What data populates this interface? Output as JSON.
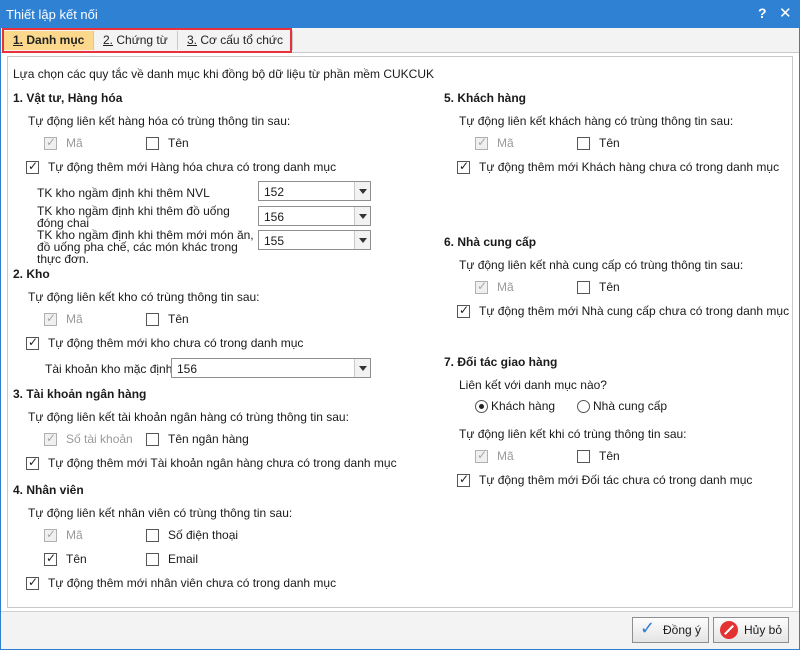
{
  "window": {
    "title": "Thiết lập kết nối",
    "help": "?",
    "close": "✕"
  },
  "tabs": [
    {
      "num": "1.",
      "label": " Danh mục"
    },
    {
      "num": "2.",
      "label": " Chứng từ"
    },
    {
      "num": "3.",
      "label": " Cơ cấu tổ chức"
    }
  ],
  "intro": "Lựa chọn các quy tắc về danh mục khi đồng bộ dữ liệu từ phần mềm CUKCUK",
  "s1": {
    "title": "1. Vật tư, Hàng hóa",
    "link_label": "Tự động liên kết hàng hóa có trùng thông tin sau:",
    "ma": "Mã",
    "ten": "Tên",
    "auto_add": "Tự động thêm mới Hàng hóa chưa có trong danh mục",
    "tk1_label": "TK kho ngầm định khi thêm NVL",
    "tk1_val": "152",
    "tk2_label": "TK kho ngầm định khi thêm đồ uống đóng chai",
    "tk2_val": "156",
    "tk3_label": "TK kho ngầm định khi thêm mới món ăn, đồ uống pha chế, các món khác trong thực đơn.",
    "tk3_val": "155"
  },
  "s2": {
    "title": "2. Kho",
    "link_label": "Tự động liên kết kho có trùng thông tin sau:",
    "ma": "Mã",
    "ten": "Tên",
    "auto_add": "Tự động thêm mới kho chưa có trong danh mục",
    "tk_label": "Tài khoản kho mặc định",
    "tk_val": "156"
  },
  "s3": {
    "title": "3. Tài khoản ngân hàng",
    "link_label": "Tự động liên kết tài khoản ngân hàng có trùng thông tin sau:",
    "so_tk": "Số tài khoản",
    "ten_nh": "Tên ngân hàng",
    "auto_add": "Tự động thêm mới Tài khoản ngân hàng chưa có trong danh mục"
  },
  "s4": {
    "title": "4. Nhân viên",
    "link_label": "Tự động liên kết nhân viên có trùng thông tin sau:",
    "ma": "Mã",
    "sdt": "Số điện thoại",
    "ten": "Tên",
    "email": "Email",
    "auto_add": "Tự động thêm mới nhân viên chưa có trong danh mục"
  },
  "s5": {
    "title": "5. Khách hàng",
    "link_label": "Tự động liên kết khách hàng có trùng thông tin sau:",
    "ma": "Mã",
    "ten": "Tên",
    "auto_add": "Tự động thêm mới Khách hàng chưa có trong danh mục"
  },
  "s6": {
    "title": "6. Nhà cung cấp",
    "link_label": "Tự động liên kết nhà cung cấp có trùng thông tin sau:",
    "ma": "Mã",
    "ten": "Tên",
    "auto_add": "Tự động thêm mới Nhà cung cấp chưa có trong danh mục"
  },
  "s7": {
    "title": "7. Đối tác giao hàng",
    "question": "Liên kết với danh mục nào?",
    "opt1": "Khách hàng",
    "opt2": "Nhà cung cấp",
    "link_label": "Tự động liên kết khi có trùng thông tin sau:",
    "ma": "Mã",
    "ten": "Tên",
    "auto_add": "Tự động thêm mới Đối tác chưa có trong danh mục"
  },
  "footer": {
    "ok": "Đồng ý",
    "cancel": "Hủy bỏ"
  },
  "colors": {
    "titlebar": "#2f81d3",
    "active_tab": "#fbd88c",
    "tab_outline": "#e8313a"
  }
}
